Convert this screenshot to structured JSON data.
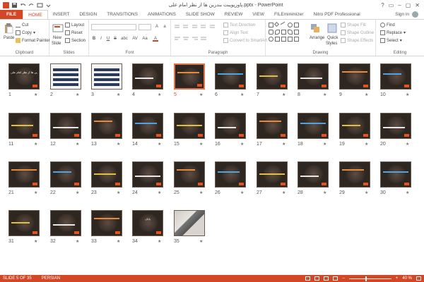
{
  "window": {
    "title": "پاورپوینت بندرین ها از نظر امام علی.pptx - PowerPoint",
    "controls": [
      "?",
      "▭",
      "–",
      "▢",
      "✕"
    ]
  },
  "tabs": [
    {
      "label": "FILE"
    },
    {
      "label": "HOME"
    },
    {
      "label": "INSERT"
    },
    {
      "label": "DESIGN"
    },
    {
      "label": "TRANSITIONS"
    },
    {
      "label": "ANIMATIONS"
    },
    {
      "label": "SLIDE SHOW"
    },
    {
      "label": "REVIEW"
    },
    {
      "label": "VIEW"
    },
    {
      "label": "FILEminimizer"
    },
    {
      "label": "Nitro PDF Professional"
    }
  ],
  "signin": "Sign in",
  "ribbon": {
    "clipboard": {
      "label": "Clipboard",
      "paste": "Paste",
      "cut": "Cut",
      "copy": "Copy",
      "format_painter": "Format Painter"
    },
    "slides": {
      "label": "Slides",
      "new_slide": "New",
      "new_slide2": "Slide",
      "layout": "Layout",
      "reset": "Reset",
      "section": "Section"
    },
    "font": {
      "label": "Font",
      "bold": "B",
      "italic": "I",
      "underline": "U",
      "strike": "S",
      "shadow": "abc",
      "spacing": "AV",
      "case": "Aa",
      "color": "A"
    },
    "paragraph": {
      "label": "Paragraph",
      "text_direction": "Text Direction",
      "align_text": "Align Text",
      "convert_smartart": "Convert to SmartArt"
    },
    "drawing": {
      "label": "Drawing",
      "arrange": "Arrange",
      "quick_styles": "Quick",
      "quick_styles2": "Styles",
      "shape_fill": "Shape Fill",
      "shape_outline": "Shape Outline",
      "shape_effects": "Shape Effects"
    },
    "editing": {
      "label": "Editing",
      "find": "Find",
      "replace": "Replace",
      "select": "Select"
    }
  },
  "slides": [
    {
      "n": "1"
    },
    {
      "n": "2"
    },
    {
      "n": "3"
    },
    {
      "n": "4"
    },
    {
      "n": "5"
    },
    {
      "n": "6"
    },
    {
      "n": "7"
    },
    {
      "n": "8"
    },
    {
      "n": "9"
    },
    {
      "n": "10"
    },
    {
      "n": "11"
    },
    {
      "n": "12"
    },
    {
      "n": "13"
    },
    {
      "n": "14"
    },
    {
      "n": "15"
    },
    {
      "n": "16"
    },
    {
      "n": "17"
    },
    {
      "n": "18"
    },
    {
      "n": "19"
    },
    {
      "n": "20"
    },
    {
      "n": "21"
    },
    {
      "n": "22"
    },
    {
      "n": "23"
    },
    {
      "n": "24"
    },
    {
      "n": "25"
    },
    {
      "n": "26"
    },
    {
      "n": "27"
    },
    {
      "n": "28"
    },
    {
      "n": "29"
    },
    {
      "n": "30"
    },
    {
      "n": "31"
    },
    {
      "n": "32"
    },
    {
      "n": "33"
    },
    {
      "n": "34"
    },
    {
      "n": "35"
    }
  ],
  "selected_slide": "5",
  "slide1_title": "بندرین ها از نظر امام علی",
  "slide34_title": "پایان",
  "star": "★",
  "status": {
    "slide_of": "SLIDE 5 OF 35",
    "language": "PERSIAN",
    "zoom_minus": "–",
    "zoom_plus": "+",
    "zoom": "40 %",
    "zoom_fraction": 0.4
  },
  "colors": {
    "accent": "#d24726",
    "slide_bg": "#2e2620",
    "selection": "#e0734d"
  }
}
